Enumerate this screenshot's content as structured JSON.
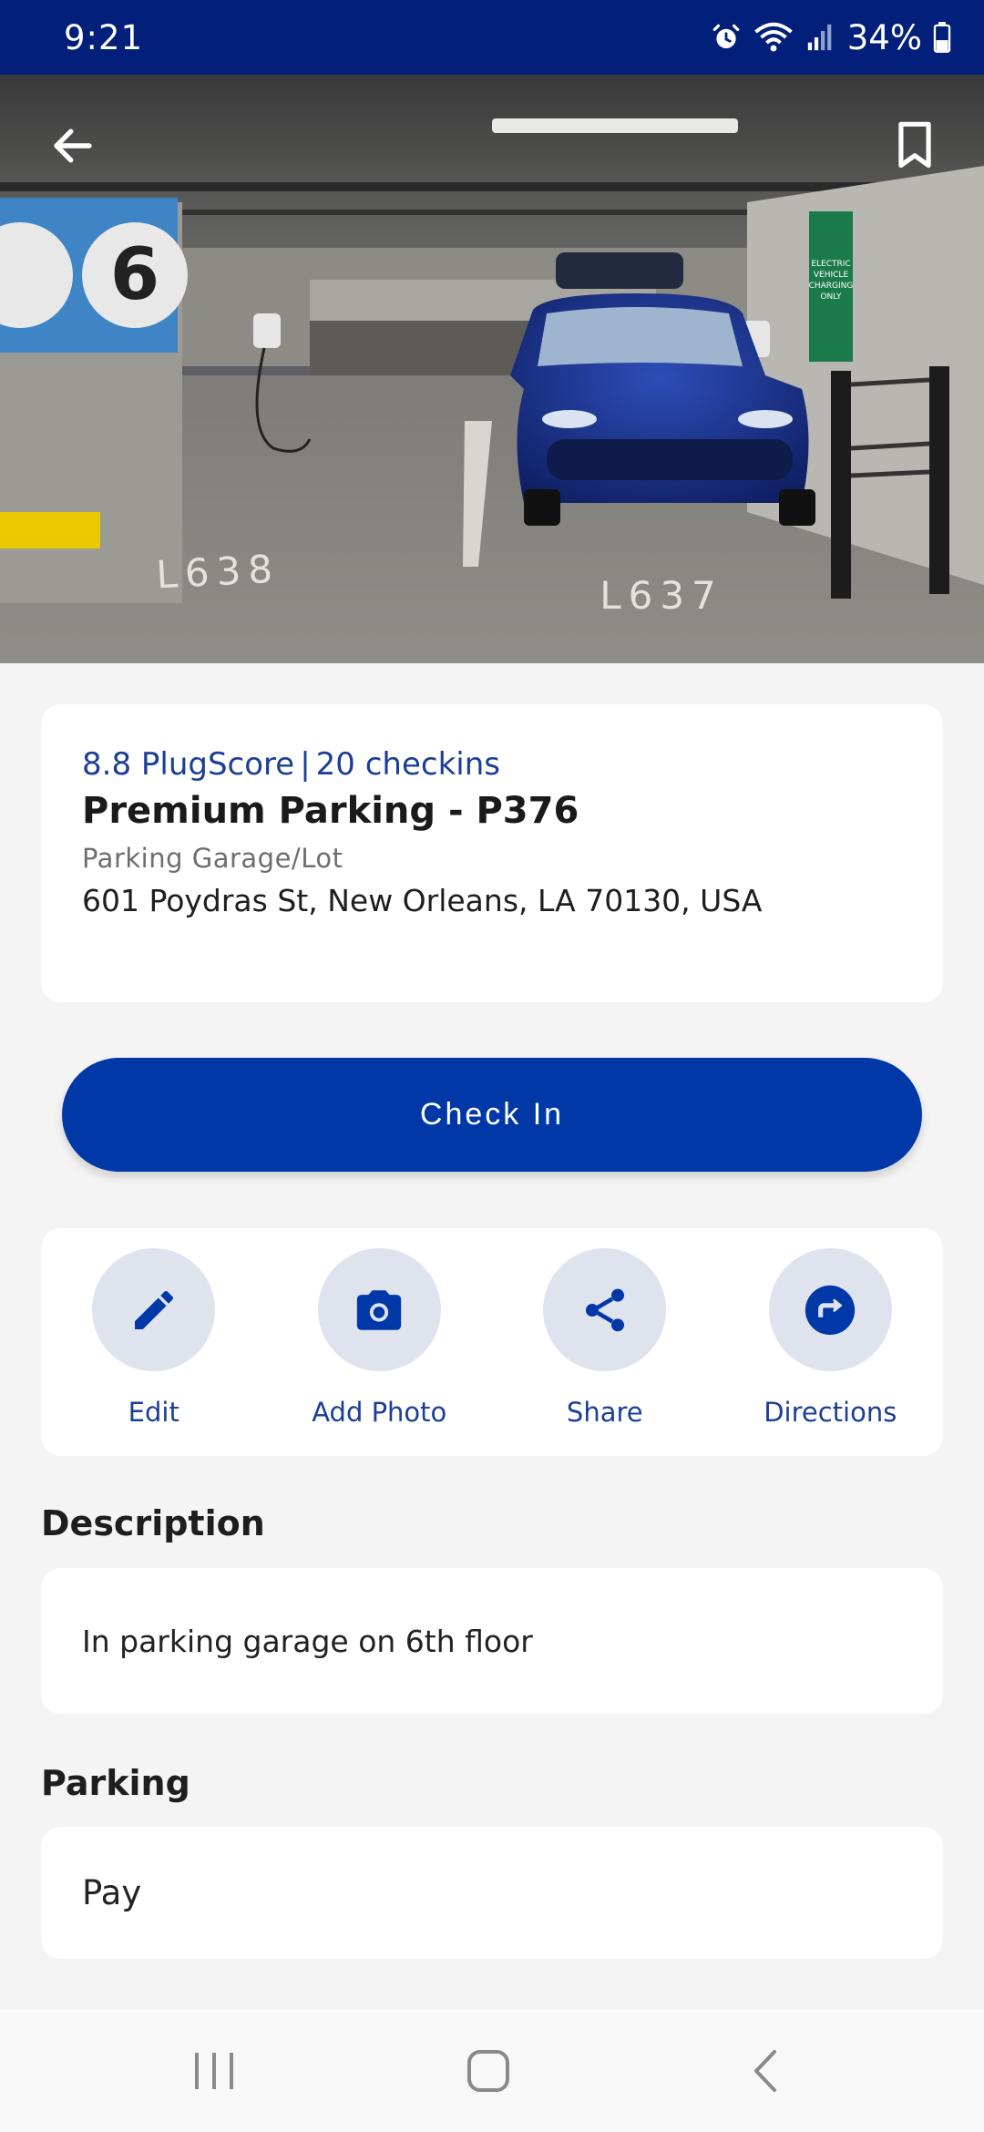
{
  "status_bar": {
    "time": "9:21",
    "battery": "34%",
    "icons": [
      "alarm-icon",
      "wifi-icon",
      "signal-icon",
      "battery-icon"
    ]
  },
  "hero": {
    "back_icon": "back-arrow-icon",
    "bookmark_icon": "bookmark-icon",
    "sign_text": [
      "ELECTRIC",
      "VEHICLE",
      "CHARGING",
      "ONLY"
    ],
    "floor_number": "6",
    "spot_labels": [
      "L638",
      "L637"
    ]
  },
  "info": {
    "plug_score": "8.8 PlugScore",
    "separator": "|",
    "checkins": "20 checkins",
    "name": "Premium Parking - P376",
    "type": "Parking Garage/Lot",
    "address": "601 Poydras St, New Orleans, LA 70130, USA"
  },
  "checkin_button": "Check In",
  "actions": [
    {
      "label": "Edit",
      "icon": "pencil-icon"
    },
    {
      "label": "Add Photo",
      "icon": "camera-icon"
    },
    {
      "label": "Share",
      "icon": "share-icon"
    },
    {
      "label": "Directions",
      "icon": "directions-icon"
    }
  ],
  "description": {
    "title": "Description",
    "text": "In parking garage on 6th floor"
  },
  "parking": {
    "title": "Parking",
    "value": "Pay"
  },
  "colors": {
    "status_bar": "#021f7a",
    "primary": "#0038a8",
    "accent_text": "#1b3f96",
    "icon_circle": "#dfe3ee"
  }
}
